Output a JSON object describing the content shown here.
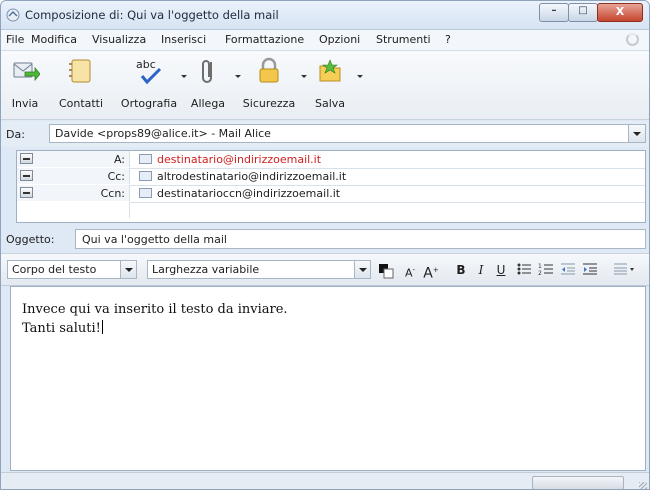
{
  "window": {
    "title": "Composizione di: Qui va l'oggetto della mail",
    "controls": {
      "minimize": "–",
      "maximize": "□",
      "close": "X"
    }
  },
  "menu": {
    "items": [
      "File",
      "Modifica",
      "Visualizza",
      "Inserisci",
      "Formattazione",
      "Opzioni",
      "Strumenti",
      "?"
    ]
  },
  "toolbar": {
    "send_label": "Invia",
    "contacts_label": "Contatti",
    "spell_label": "Ortografia",
    "spell_icon_text": "abc",
    "attach_label": "Allega",
    "security_label": "Sicurezza",
    "save_label": "Salva"
  },
  "from": {
    "label": "Da:",
    "value": "Davide <props89@alice.it>  - Mail Alice"
  },
  "recipients": [
    {
      "type": "A:",
      "address": "destinatario@indirizzoemail.it",
      "color": "#d02020"
    },
    {
      "type": "Cc:",
      "address": "altrodestinatario@indirizzoemail.it",
      "color": "#1e1e1e"
    },
    {
      "type": "Ccn:",
      "address": "destinatarioccn@indirizzoemail.it",
      "color": "#1e1e1e"
    }
  ],
  "subject": {
    "label": "Oggetto:",
    "value": "Qui va l'oggetto della mail"
  },
  "format": {
    "paragraph_style": "Corpo del testo",
    "font": "Larghezza variabile",
    "smaller_label": "A",
    "larger_label": "A",
    "bold_label": "B",
    "italic_label": "I",
    "underline_label": "U"
  },
  "body": {
    "lines": [
      "Invece qui va inserito il testo da inviare.",
      "Tanti saluti!"
    ]
  },
  "colors": {
    "accent": "#3f78c4",
    "to_address": "#d02020",
    "window_bg": "#dfe9f5"
  },
  "icons": [
    "app-icon",
    "send-icon",
    "contacts-icon",
    "spellcheck-icon",
    "attach-icon",
    "security-lock-icon",
    "save-icon",
    "throbber-icon",
    "contact-card-icon",
    "text-color-icon",
    "bullet-list-icon",
    "numbered-list-icon",
    "outdent-icon",
    "indent-icon",
    "align-icon"
  ]
}
